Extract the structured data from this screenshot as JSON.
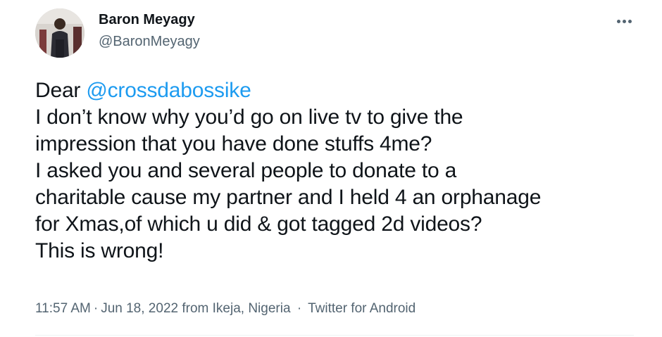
{
  "author": {
    "display_name": "Baron Meyagy",
    "handle": "@BaronMeyagy"
  },
  "tweet": {
    "line1_prefix": "Dear ",
    "mention": "@crossdabossike",
    "lines": [
      "I don’t know why you’d go on live tv to give the",
      "impression that you have done stuffs 4me?",
      "I asked you and several people to donate to a",
      "charitable cause my partner and I held 4 an orphanage",
      "for Xmas,of which u did & got tagged 2d videos?",
      "This is wrong!"
    ]
  },
  "meta": {
    "time": "11:57 AM",
    "date": "Jun 18, 2022",
    "from_label": "from",
    "location": "Ikeja, Nigeria",
    "separator": "·",
    "source": "Twitter for Android"
  },
  "icons": {
    "more": "more-horizontal-icon"
  },
  "colors": {
    "mention": "#1d9bf0",
    "secondary_text": "#536471",
    "primary_text": "#0f1419"
  }
}
